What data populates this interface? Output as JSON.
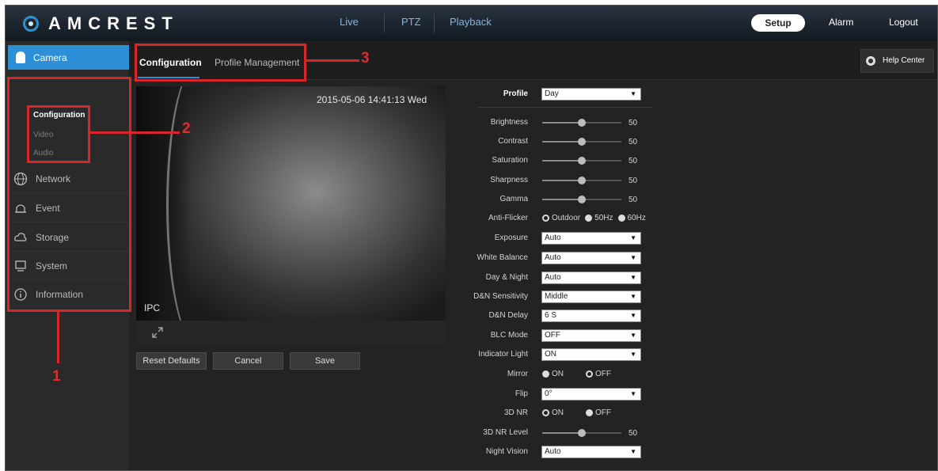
{
  "header": {
    "brand": "AMCREST",
    "nav": [
      "Live",
      "PTZ",
      "Playback"
    ],
    "setup": "Setup",
    "alarm": "Alarm",
    "logout": "Logout"
  },
  "sidebar": {
    "camera": "Camera",
    "camera_sub": [
      "Configuration",
      "Video",
      "Audio"
    ],
    "items": [
      "Network",
      "Event",
      "Storage",
      "System",
      "Information"
    ]
  },
  "tabs": {
    "configuration": "Configuration",
    "profile_management": "Profile Management",
    "help_center": "Help Center"
  },
  "video": {
    "timestamp": "2015-05-06 14:41:13 Wed",
    "channel": "IPC"
  },
  "buttons": {
    "reset": "Reset Defaults",
    "cancel": "Cancel",
    "save": "Save"
  },
  "settings": {
    "profile": {
      "label": "Profile",
      "value": "Day"
    },
    "brightness": {
      "label": "Brightness",
      "value": 50
    },
    "contrast": {
      "label": "Contrast",
      "value": 50
    },
    "saturation": {
      "label": "Saturation",
      "value": 50
    },
    "sharpness": {
      "label": "Sharpness",
      "value": 50
    },
    "gamma": {
      "label": "Gamma",
      "value": 50
    },
    "anti_flicker": {
      "label": "Anti-Flicker",
      "options": [
        "Outdoor",
        "50Hz",
        "60Hz"
      ],
      "selected": "Outdoor"
    },
    "exposure": {
      "label": "Exposure",
      "value": "Auto"
    },
    "white_balance": {
      "label": "White Balance",
      "value": "Auto"
    },
    "day_night": {
      "label": "Day & Night",
      "value": "Auto"
    },
    "dn_sensitivity": {
      "label": "D&N Sensitivity",
      "value": "Middle"
    },
    "dn_delay": {
      "label": "D&N Delay",
      "value": "6 S"
    },
    "blc_mode": {
      "label": "BLC Mode",
      "value": "OFF"
    },
    "indicator_light": {
      "label": "Indicator Light",
      "value": "ON"
    },
    "mirror": {
      "label": "Mirror",
      "options": [
        "ON",
        "OFF"
      ],
      "selected": "OFF"
    },
    "flip": {
      "label": "Flip",
      "value": "0°"
    },
    "nr3d": {
      "label": "3D NR",
      "options": [
        "ON",
        "OFF"
      ],
      "selected": "ON"
    },
    "nr3d_level": {
      "label": "3D NR Level",
      "value": 50
    },
    "night_vision": {
      "label": "Night Vision",
      "value": "Auto"
    }
  },
  "annotations": [
    "1",
    "2",
    "3"
  ],
  "colors": {
    "accent": "#2d8fd6",
    "annotation": "#d9262b"
  }
}
